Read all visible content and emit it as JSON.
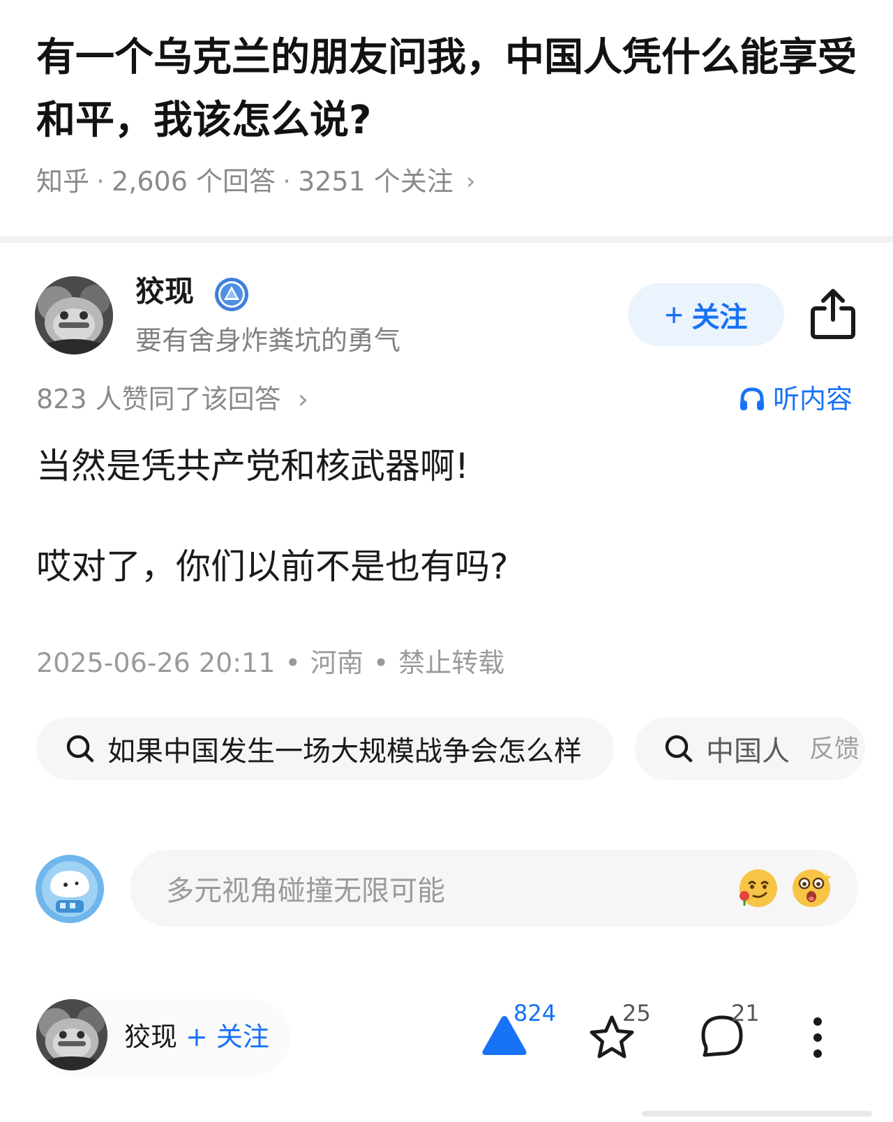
{
  "question": {
    "title": "有一个乌克兰的朋友问我，中国人凭什么能享受和平，我该怎么说?",
    "source": "知乎",
    "answers_count": "2,606 个回答",
    "followers_count": "3251 个关注",
    "separator": "·",
    "chevron": "›"
  },
  "author": {
    "name": "狡现",
    "bio": "要有舍身炸粪坑的勇气",
    "badge_icon": "verified-badge-icon",
    "follow_label": "关注",
    "follow_plus": "+",
    "share_icon": "share-icon"
  },
  "answer": {
    "upvote_info": "823 人赞同了该回答",
    "chevron": "›",
    "listen_label": "听内容",
    "listen_icon": "headphones-icon",
    "paragraphs": [
      "当然是凭共产党和核武器啊!",
      "哎对了，你们以前不是也有吗?"
    ],
    "date": "2025-06-26 20:11",
    "location": "河南",
    "copyright": "禁止转载",
    "dot": "•"
  },
  "related_searches": [
    {
      "label": "如果中国发生一场大规模战争会怎么样"
    },
    {
      "label": "中国人"
    }
  ],
  "feedback_label": "反馈",
  "comment": {
    "placeholder": "多元视角碰撞无限可能"
  },
  "bottom_bar": {
    "author_name": "狡现",
    "follow_label": "+ 关注",
    "upvote_count": "824",
    "favorite_count": "25",
    "comment_count": "21"
  },
  "colors": {
    "accent": "#1772f6",
    "text": "#1a1a1a",
    "muted": "#8a8a8a",
    "chip_bg": "#f6f6f6"
  }
}
